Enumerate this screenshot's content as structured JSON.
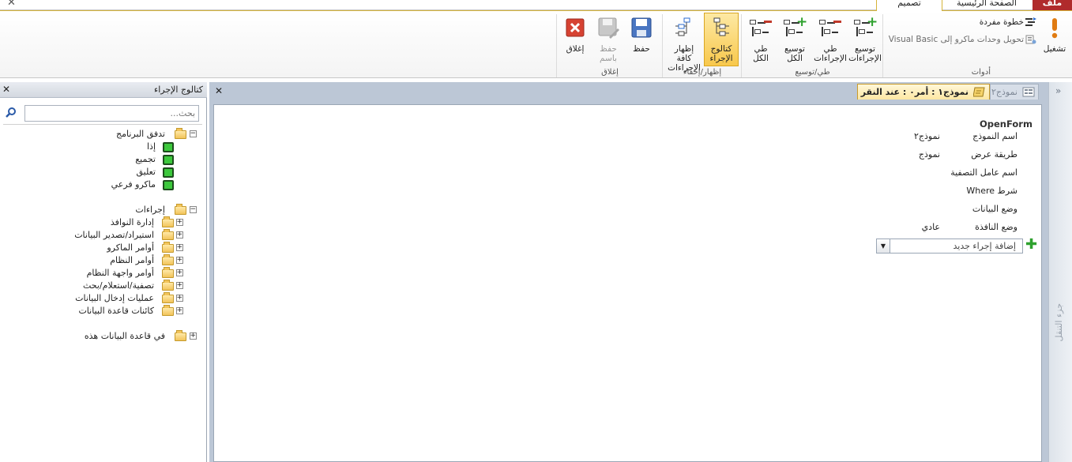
{
  "tabs": {
    "file": "ملف",
    "home": "الصفحة الرئيسية",
    "design": "تصميم"
  },
  "ribbon": {
    "tools": {
      "group_label": "أدوات",
      "run": "تشغيل",
      "single_step": "خطوة مفردة",
      "convert": "تحويل وحدات ماكرو إلى Visual Basic"
    },
    "collapse_expand": {
      "group_label": "طي/توسيع",
      "expand_actions": [
        "توسيع",
        "الإجراءات"
      ],
      "collapse_actions": [
        "طي",
        "الإجراءات"
      ],
      "expand_all": [
        "توسيع",
        "الكل"
      ],
      "collapse_all": [
        "طي",
        "الكل"
      ]
    },
    "show_hide": {
      "group_label": "إظهار/إخفاء",
      "action_catalog": [
        "كتالوج",
        "الإجراء"
      ],
      "show_all_actions": [
        "إظهار كافة",
        "الإجراءات"
      ]
    },
    "close": {
      "group_label": "إغلاق",
      "save": "حفظ",
      "save_as": [
        "حفظ",
        "باسم"
      ],
      "close": "إغلاق"
    }
  },
  "catalog": {
    "title": "كتالوج الإجراء",
    "search_placeholder": "بحث...",
    "program_flow": {
      "label": "تدفق البرنامج",
      "items": [
        "إذا",
        "تجميع",
        "تعليق",
        "ماكرو فرعي"
      ]
    },
    "actions": {
      "label": "إجراءات",
      "items": [
        "إدارة النوافذ",
        "استيراد/تصدير البيانات",
        "أوامر الماكرو",
        "أوامر النظام",
        "أوامر واجهة النظام",
        "تصفية/استعلام/بحث",
        "عمليات إدخال البيانات",
        "كائنات قاعدة البيانات"
      ]
    },
    "in_this_database": "في قاعدة البيانات هذه"
  },
  "document": {
    "active_tab": "نموذج١ : أمر٠ : عند النقر",
    "inactive_tab": "نموذج٢",
    "action_name": "OpenForm",
    "arguments": [
      {
        "label": "اسم النموذج",
        "value": "نموذج٢"
      },
      {
        "label": "طريقة عرض",
        "value": "نموذج"
      },
      {
        "label": "اسم عامل التصفية",
        "value": ""
      },
      {
        "label": "شرط Where",
        "value": ""
      },
      {
        "label": "وضع البيانات",
        "value": ""
      },
      {
        "label": "وضع النافذة",
        "value": "عادي"
      }
    ],
    "add_action_placeholder": "إضافة إجراء جديد"
  },
  "nav_pane": {
    "label": "جزء التنقل"
  },
  "colors": {
    "file_tab": "#b02b2c",
    "active_accent": "#f8c84c",
    "plus_green": "#2ea12e"
  }
}
